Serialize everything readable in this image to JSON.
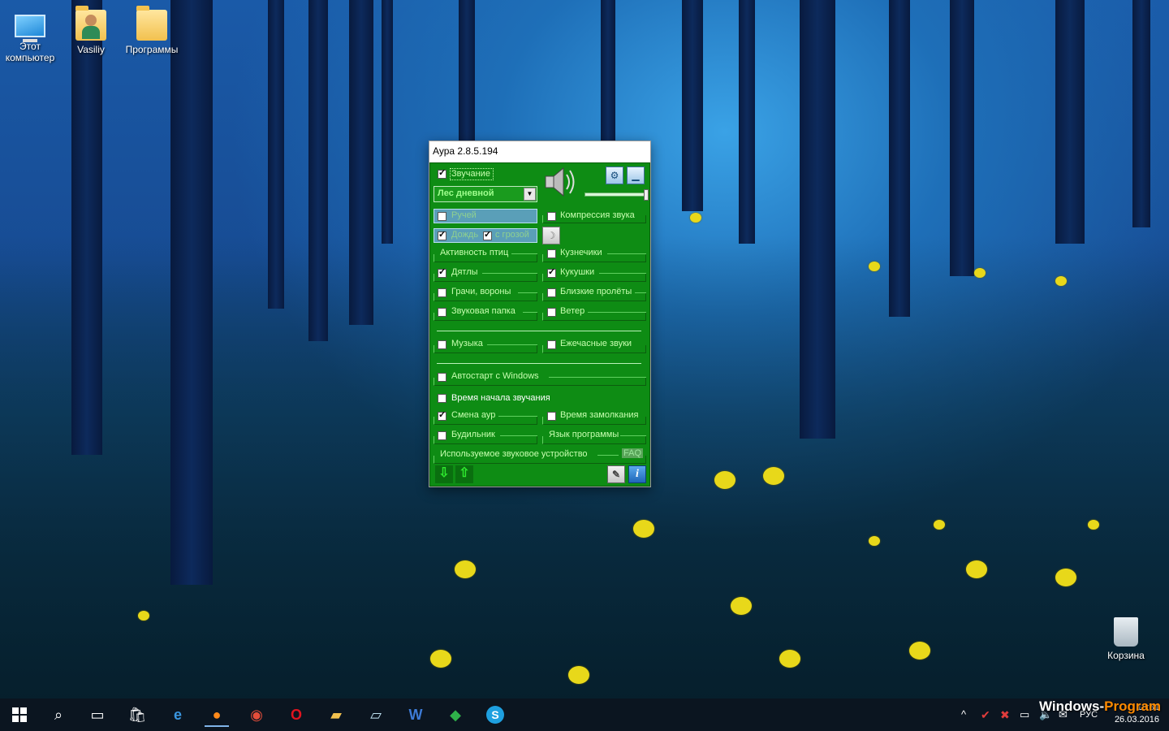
{
  "desktop": {
    "icons": [
      {
        "label_line1": "Этот",
        "label_line2": "компьютер",
        "icon": "computer-icon"
      },
      {
        "label_line1": "Vasiliy",
        "label_line2": "",
        "icon": "user-folder-icon"
      },
      {
        "label_line1": "Программы",
        "label_line2": "",
        "icon": "folder-icon"
      },
      {
        "label_line1": "Корзина",
        "label_line2": "",
        "icon": "recycle-bin-icon"
      }
    ]
  },
  "window": {
    "title": "Аура 2.8.5.194",
    "sound_label": "Звучание",
    "sound_checked": true,
    "preset": "Лес дневной",
    "items": {
      "stream": "Ручей",
      "rain": "Дождь",
      "storm": "с грозой",
      "birds": "Активность птиц",
      "woodpeckers": "Дятлы",
      "rooks": "Грачи, вороны",
      "sound_folder": "Звуковая папка",
      "music": "Музыка",
      "autostart": "Автостарт с Windows",
      "start_time": "Время начала звучания",
      "aura_change": "Смена аур",
      "alarm": "Будильник",
      "device": "Используемое звуковое устройство",
      "compression": "Компрессия звука",
      "grasshoppers": "Кузнечики",
      "cuckoos": "Кукушки",
      "flyovers": "Близкие пролёты",
      "wind": "Ветер",
      "hourly": "Ежечасные звуки",
      "sleep_time": "Время замолкания",
      "language": "Язык программы",
      "faq": "FAQ"
    },
    "checks": {
      "rain": true,
      "storm": true,
      "woodpeckers": true,
      "cuckoos": true,
      "aura_change": true
    }
  },
  "taskbar": {
    "icons": [
      "windows-start-icon",
      "search-icon",
      "task-view-icon",
      "store-icon",
      "edge-icon",
      "firefox-icon",
      "chrome-icon",
      "opera-icon",
      "explorer-icon",
      "notes-icon",
      "word-icon",
      "media-icon",
      "skype-icon"
    ],
    "language": "РУС",
    "time": "18:31",
    "date": "26.03.2016"
  },
  "watermark": {
    "part1": "Windows-",
    "part2": "Program"
  },
  "colors": {
    "panel": "#0e8c14",
    "label": "#c7ffb0",
    "accent": "#ff8a00"
  }
}
